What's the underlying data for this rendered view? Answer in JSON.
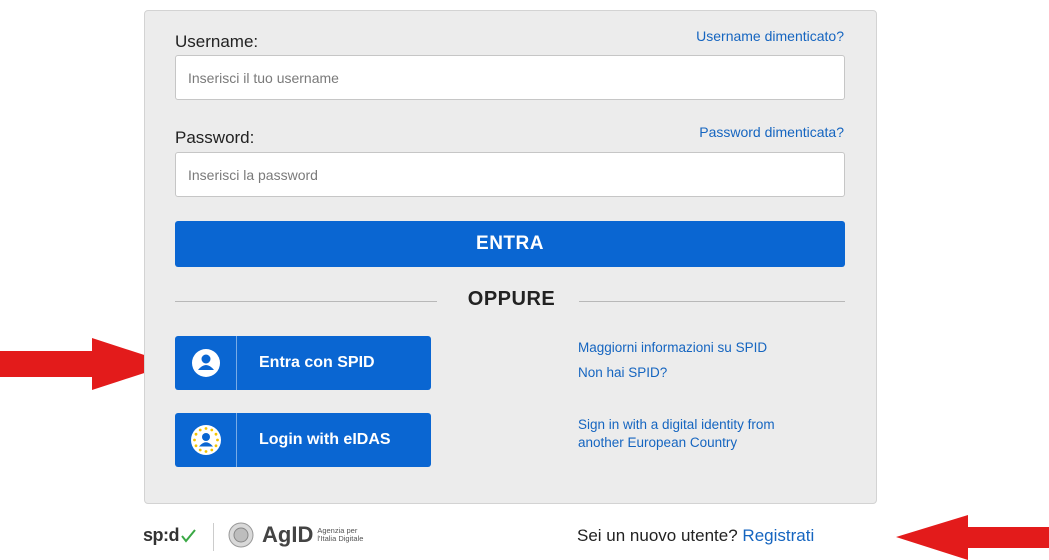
{
  "login": {
    "username_label": "Username:",
    "username_forgot": "Username dimenticato?",
    "username_placeholder": "Inserisci il tuo username",
    "password_label": "Password:",
    "password_forgot": "Password dimenticata?",
    "password_placeholder": "Inserisci la password",
    "submit_label": "ENTRA",
    "or_label": "OPPURE"
  },
  "spid": {
    "button_label": "Entra con SPID",
    "more_info": "Maggiorni informazioni su SPID",
    "no_spid": "Non hai SPID?"
  },
  "eidas": {
    "button_label": "Login with eIDAS",
    "info_line1": "Sign in with a digital identity from",
    "info_line2": "another European Country"
  },
  "footer": {
    "spid_logo": "sp:d",
    "agid_logo": "AgID",
    "agid_sub1": "Agenzia per",
    "agid_sub2": "l'Italia Digitale",
    "new_user_text": "Sei un nuovo utente?",
    "register_link": "Registrati"
  },
  "colors": {
    "primary": "#0a66d2",
    "link": "#1565c0",
    "arrow": "#e31b1b",
    "panel": "#ececec"
  },
  "icons": [
    "user-circle-icon",
    "eu-stars-icon",
    "arrow-right-icon",
    "arrow-left-icon",
    "checkmark-icon",
    "agid-emblem-icon"
  ]
}
